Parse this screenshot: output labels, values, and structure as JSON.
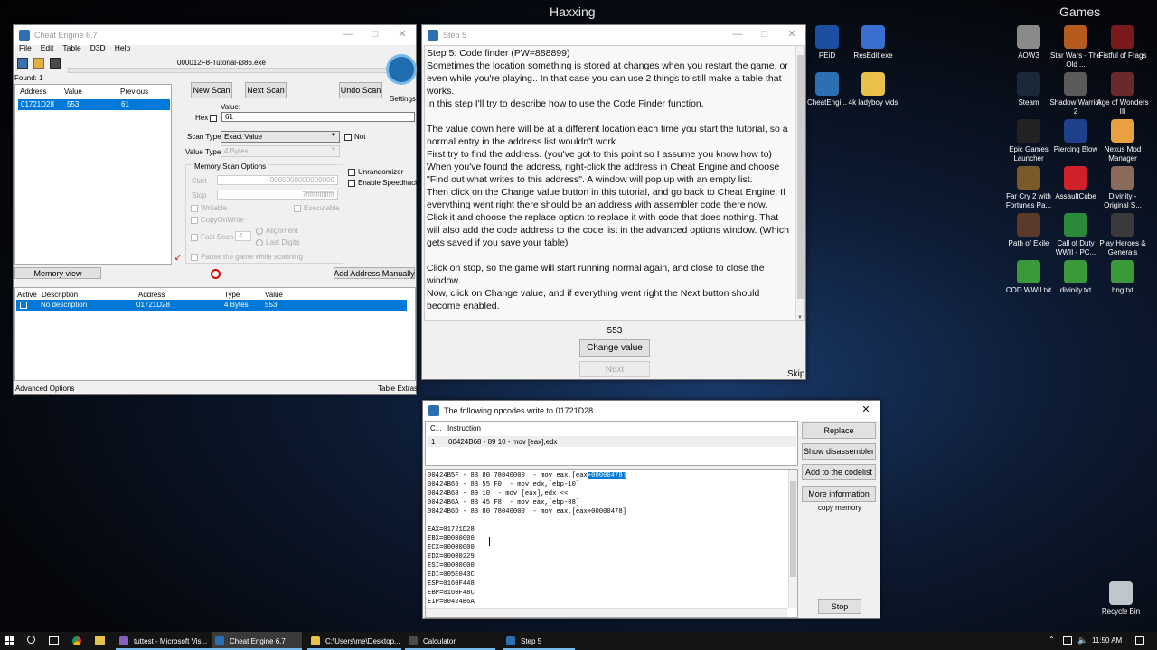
{
  "desktop": {
    "group1": "Haxxing",
    "group2": "Games",
    "icons": [
      {
        "label": "PEiD",
        "color": "#1d4fa0"
      },
      {
        "label": "ResEdit.exe",
        "color": "#3a6fcf"
      },
      {
        "label": "AOW3",
        "color": "#8a8a8a"
      },
      {
        "label": "Star Wars - The Old ...",
        "color": "#b35a1c"
      },
      {
        "label": "Fistful of Frags",
        "color": "#7a1a1a"
      },
      {
        "label": "CheatEngi...",
        "color": "#2c6fb3"
      },
      {
        "label": "4k ladyboy vids",
        "color": "#e8c04c"
      },
      {
        "label": "Steam",
        "color": "#1b2838"
      },
      {
        "label": "Shadow Warrior 2",
        "color": "#5a5a5a"
      },
      {
        "label": "Age of Wonders III",
        "color": "#6a2a2a"
      },
      {
        "label": "Epic Games Launcher",
        "color": "#222222"
      },
      {
        "label": "Piercing Blow",
        "color": "#1e3f8a"
      },
      {
        "label": "Nexus Mod Manager",
        "color": "#e8a040"
      },
      {
        "label": "Far Cry 2 with Fortunes Pa...",
        "color": "#7a5a2a"
      },
      {
        "label": "AssaultCube",
        "color": "#d0202a"
      },
      {
        "label": "Divinity - Original S...",
        "color": "#8a6a5a"
      },
      {
        "label": "Path of Exile",
        "color": "#5a3a2a"
      },
      {
        "label": "Call of Duty WWII - PC...",
        "color": "#2a8a3a"
      },
      {
        "label": "Play Heroes & Generals",
        "color": "#3a3a3a"
      },
      {
        "label": "COD WWII.txt",
        "color": "#3a9a3a"
      },
      {
        "label": "divinity.txt",
        "color": "#3a9a3a"
      },
      {
        "label": "hng.txt",
        "color": "#3a9a3a"
      },
      {
        "label": "Recycle Bin",
        "color": "#c0c6cc"
      }
    ]
  },
  "ce": {
    "title": "Cheat Engine 6.7",
    "menu": [
      "File",
      "Edit",
      "Table",
      "D3D",
      "Help"
    ],
    "process": "000012F8-Tutorial-i386.exe",
    "found": "Found: 1",
    "cols": {
      "address": "Address",
      "value": "Value",
      "previous": "Previous"
    },
    "result": {
      "address": "01721D28",
      "value": "553",
      "previous": "61"
    },
    "new_scan": "New Scan",
    "next_scan": "Next Scan",
    "undo_scan": "Undo Scan",
    "settings": "Settings",
    "value_label": "Value:",
    "hex": "Hex",
    "value_input": "61",
    "scan_type_label": "Scan Type",
    "scan_type": "Exact Value",
    "not": "Not",
    "value_type_label": "Value Type",
    "value_type": "4 Bytes",
    "mem_opts": "Memory Scan Options",
    "start_label": "Start",
    "start_val": "0000000000000000",
    "stop_label": "Stop",
    "stop_val": "7fffffffffffffff",
    "writable": "Writable",
    "executable": "Executable",
    "copyonwrite": "CopyOnWrite",
    "fast_scan": "Fast Scan",
    "fast_val": "4",
    "alignment": "Alignment",
    "last_digits": "Last Digits",
    "pause": "Pause the game while scanning",
    "unrandomizer": "Unrandomizer",
    "speedhack": "Enable Speedhack",
    "memory_view": "Memory view",
    "add_manually": "Add Address Manually",
    "tcols": {
      "active": "Active",
      "desc": "Description",
      "address": "Address",
      "type": "Type",
      "value": "Value"
    },
    "trow": {
      "desc": "No description",
      "address": "01721D28",
      "type": "4 Bytes",
      "value": "553"
    },
    "advanced": "Advanced Options",
    "extras": "Table Extras"
  },
  "step": {
    "title": "Step 5",
    "paragraphs": [
      "Step 5: Code finder (PW=888899)",
      "Sometimes the location something is stored at changes when you restart the game, or even while you're playing.. In that case you can use 2 things to still make a table that works.",
      "In this step I'll try to describe how to use the Code Finder function.",
      "",
      "The value down here will be at a different location each time you start the tutorial, so a normal entry in the address list wouldn't work.",
      "First try to find the address. (you've got to this point so I assume you know how to)",
      "When you've found the address, right-click the address in Cheat Engine and choose \"Find out what writes to this address\". A window will pop up with an empty list.",
      "Then click on the Change value button in this tutorial, and go back to Cheat Engine. If everything went right there should be an address with assembler code there now.",
      "Click it and choose the replace option to replace it with code that does nothing. That will also add the code address to the code list in the advanced options window. (Which gets saved if you save your table)",
      "",
      "Click on stop, so the game will start running normal again, and close to close the window.",
      "Now, click on Change value, and if everything went right the Next button should become enabled."
    ],
    "value": "553",
    "change_value": "Change value",
    "next": "Next",
    "skip": "Skip"
  },
  "opcodes": {
    "title": "The following opcodes write to 01721D28",
    "col_count": "C...",
    "col_instruction": "Instruction",
    "row_count": "1",
    "row_instruction": "00424B68 - 89 10  - mov [eax],edx",
    "replace": "Replace",
    "show_disassembler": "Show disassembler",
    "add_codelist": "Add to the codelist",
    "more_info": "More information",
    "copy_memory": "copy memory",
    "stop": "Stop",
    "code_lines": [
      "00424B5F - 8B 80 78040000  - mov eax,[eax",
      "00424B65 - 8B 55 F0  - mov edx,[ebp-10]",
      "00424B68 - 89 10  - mov [eax],edx <<",
      "00424B6A - 8B 45 F8  - mov eax,[ebp-08]",
      "00424B6D - 8B 80 78040000  - mov eax,[eax+00000478]",
      "",
      "EAX=01721D28",
      "EBX=00000000",
      "ECX=00000000",
      "EDX=00000229",
      "ESI=00000000",
      "EDI=005E043C",
      "ESP=0160F448",
      "EBP=0160F48C",
      "EIP=00424B6A"
    ],
    "highlight": "+00000478]"
  },
  "taskbar": {
    "items": [
      {
        "label": "tuttest - Microsoft Vis...",
        "color": "#865fc5"
      },
      {
        "label": "Cheat Engine 6.7",
        "color": "#2c6fb3"
      },
      {
        "label": "C:\\Users\\me\\Desktop...",
        "color": "#e8c04c"
      },
      {
        "label": "Calculator",
        "color": "#4a4a4a"
      },
      {
        "label": "Step 5",
        "color": "#2c6fb3"
      }
    ],
    "clock": "11:50 AM"
  }
}
